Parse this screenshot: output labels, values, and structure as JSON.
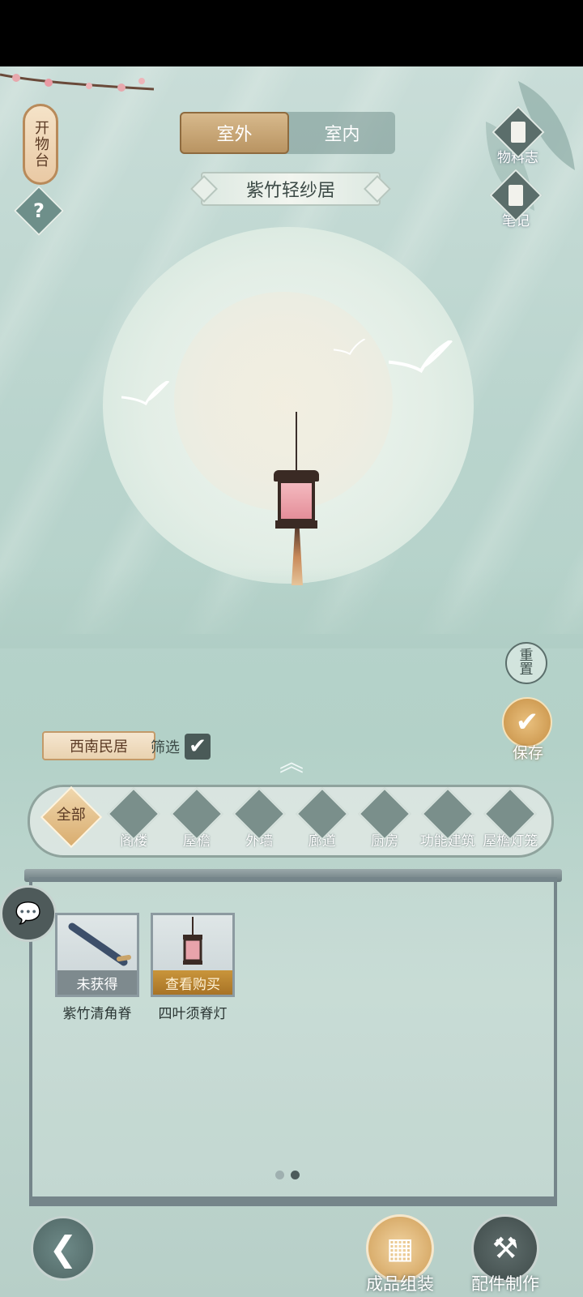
{
  "top_left": {
    "plaque_text": "开物台",
    "help_label": "?"
  },
  "tabs": [
    {
      "label": "室外",
      "active": true
    },
    {
      "label": "室内",
      "active": false
    }
  ],
  "location_title": "紫竹轻纱居",
  "right_side": {
    "materials_label": "物料志",
    "notes_label": "笔记",
    "reset_label": "重置",
    "save_label": "保存"
  },
  "filter": {
    "region": "西南民居",
    "filter_label": "筛选",
    "filter_checked": true
  },
  "categories": [
    {
      "label": "全部",
      "icon": "all-icon",
      "active": true
    },
    {
      "label": "阁楼",
      "icon": "attic-icon"
    },
    {
      "label": "屋檐",
      "icon": "eaves-icon"
    },
    {
      "label": "外墙",
      "icon": "wall-icon"
    },
    {
      "label": "廊道",
      "icon": "corridor-icon"
    },
    {
      "label": "厨房",
      "icon": "kitchen-icon"
    },
    {
      "label": "功能建筑",
      "icon": "building-icon"
    },
    {
      "label": "屋檐灯笼",
      "icon": "lantern-icon"
    }
  ],
  "items": [
    {
      "name": "紫竹清角脊",
      "status": "未获得",
      "icon": "ridge-beam-icon"
    },
    {
      "name": "四叶须脊灯",
      "status": "查看购买",
      "icon": "lantern-icon"
    }
  ],
  "pagination": {
    "current": 2,
    "total": 2
  },
  "bottom": {
    "assemble_label": "成品组装",
    "craft_label": "配件制作"
  },
  "colors": {
    "accent_gold": "#c68f44",
    "panel_frame": "#75858a",
    "scene_bg": "#b9d4cd"
  }
}
